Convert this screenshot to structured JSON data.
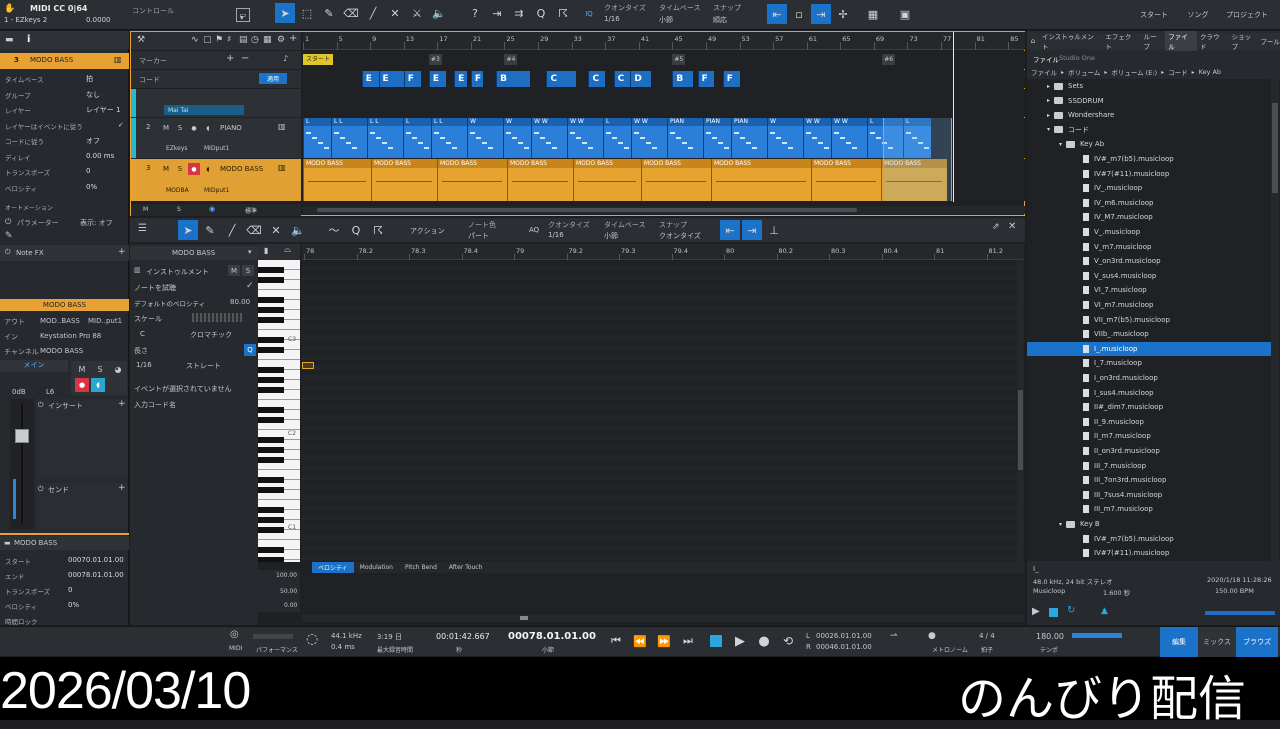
{
  "colors": {
    "accent": "#1b73c9",
    "orange": "#e8a234",
    "bg": "#1c1e21"
  },
  "topbar": {
    "song_title": "MIDI CC 0|64",
    "song_sub": "1 - EZkeys 2",
    "value": "0.0000",
    "control_label": "コントロール",
    "quantize_label": "クオンタイズ",
    "quantize_value": "1/16",
    "timebase_label": "タイムベース",
    "timebase_value": "小節",
    "snap_label": "スナップ",
    "snap_value": "順応",
    "iq": "IQ",
    "nav": [
      "スタート",
      "ソング",
      "プロジェクト"
    ]
  },
  "inspector": {
    "track_num": "3",
    "track_name": "MODO BASS",
    "rows": [
      {
        "label": "タイムベース",
        "value": "拍"
      },
      {
        "label": "グループ",
        "value": "なし"
      },
      {
        "label": "レイヤー",
        "value": "レイヤー 1"
      },
      {
        "label": "レイヤーはイベントに従う",
        "value": "✓"
      },
      {
        "label": "コードに従う",
        "value": "オフ"
      },
      {
        "label": "ディレイ",
        "value": "0.00 ms"
      },
      {
        "label": "トランスポーズ",
        "value": "0"
      },
      {
        "label": "ベロシティ",
        "value": "0%"
      }
    ],
    "automation": "オートメーション",
    "param_label": "パラメーター",
    "param_value": "表示: オフ",
    "note_fx": "Note FX",
    "channel_title": "MODO BASS",
    "out_label": "アウト",
    "out_value": "MOD..BASS",
    "out_value2": "MID..put1",
    "in_label": "イン",
    "in_value": "Keystation Pro 88",
    "ch_label": "チャンネル",
    "ch_value": "MODO BASS",
    "main": "メイン",
    "db": "0dB",
    "pan": "L6",
    "insert": "インサート",
    "send": "センド",
    "event_title": "MODO BASS",
    "event_rows": [
      {
        "label": "スタート",
        "value": "00070.01.01.00"
      },
      {
        "label": "エンド",
        "value": "00078.01.01.00"
      },
      {
        "label": "トランスポーズ",
        "value": "0"
      },
      {
        "label": "ベロシティ",
        "value": "0%"
      },
      {
        "label": "時間ロック",
        "value": ""
      }
    ]
  },
  "arrange": {
    "ruler": [
      "1",
      "5",
      "9",
      "13",
      "17",
      "21",
      "25",
      "29",
      "33",
      "37",
      "41",
      "45",
      "49",
      "53",
      "57",
      "61",
      "65",
      "69",
      "73",
      "77",
      "81",
      "85"
    ],
    "marker_label": "マーカー",
    "chord_label": "コード",
    "chord_btn": "適用",
    "start_marker": "スタート",
    "markers": [
      "#3",
      "#4",
      "#5",
      "#6"
    ],
    "chords": [
      "E",
      "E",
      "F",
      "E",
      "E",
      "F",
      "B",
      "C",
      "C",
      "C",
      "D",
      "B",
      "F",
      "F"
    ],
    "tracks": [
      {
        "num": "",
        "name": "Mai Tai",
        "sub": ""
      },
      {
        "num": "2",
        "name": "PIANO",
        "sub": "EZkeys",
        "sub2": "MIDput1"
      },
      {
        "num": "3",
        "name": "MODO BASS",
        "sub": "MODBA",
        "sub2": "MIDput1"
      }
    ],
    "piano_clips": [
      "L",
      "L L",
      "L L",
      "L",
      "L L",
      "W",
      "W",
      "W W",
      "W W",
      "L",
      "W W",
      "PIAN",
      "PIAN",
      "PIAN",
      "W",
      "W W",
      "W W",
      "L",
      "L"
    ],
    "bass_clips": [
      "MODO BASS",
      "MODO BASS",
      "MODO BASS",
      "MODO BASS",
      "MODO BASS",
      "MODO BASS",
      "MODO BASS",
      "MODO BASS",
      "MODO BASS"
    ],
    "footer_m": "M",
    "footer_s": "S",
    "footer_std": "標準"
  },
  "editor": {
    "action": "アクション",
    "notecolor_label": "ノート色",
    "notecolor_value": "パート",
    "quantize_label": "クオンタイズ",
    "quantize_value": "1/16",
    "timebase_label": "タイムベース",
    "timebase_value": "小節",
    "snap_label": "スナップ",
    "snap_value": "クオンタイズ",
    "aq": "AQ",
    "track_name": "MODO BASS",
    "instrument": "インストゥルメント",
    "note_preview": "ノートを試聴",
    "default_vel_label": "デフォルトのベロシティ",
    "default_vel": "80.00",
    "scale": "スケール",
    "scale_key": "C",
    "scale_type": "クロマチック",
    "length": "長さ",
    "len_value": "1/16",
    "len_type": "ストレート",
    "no_event": "イベントが選択されていません",
    "input_chord": "入力コード名",
    "ruler": [
      "78",
      "78.2",
      "78.3",
      "78.4",
      "79",
      "79.2",
      "79.3",
      "79.4",
      "80",
      "80.2",
      "80.3",
      "80.4",
      "81",
      "81.2"
    ],
    "key_labels": [
      "C3",
      "C2",
      "C1"
    ],
    "lanes": [
      "ベロシティ",
      "Modulation",
      "Pitch Bend",
      "After Touch"
    ],
    "vel_scale": [
      "100.00",
      "50.00",
      "0.00"
    ]
  },
  "browser": {
    "tabs": [
      "インストゥルメント",
      "エフェクト",
      "ループ",
      "ファイル",
      "クラウド",
      "ショップ",
      "プール"
    ],
    "sub1": "ファイル",
    "sub2": "Studio One",
    "crumbs": [
      "ファイル",
      "ボリューム",
      "ボリューム (E:)",
      "コード",
      "Key Ab"
    ],
    "items": [
      {
        "t": "Sets",
        "lvl": 1,
        "type": "folder"
      },
      {
        "t": "SSDDRUM",
        "lvl": 1,
        "type": "folder"
      },
      {
        "t": "Wondershare",
        "lvl": 1,
        "type": "folder"
      },
      {
        "t": "コード",
        "lvl": 1,
        "type": "folder"
      },
      {
        "t": "Key Ab",
        "lvl": 2,
        "type": "folder"
      },
      {
        "t": "IV#_m7(b5).musicloop",
        "lvl": 3,
        "type": "file"
      },
      {
        "t": "IV#7(#11).musicloop",
        "lvl": 3,
        "type": "file"
      },
      {
        "t": "IV_.musicloop",
        "lvl": 3,
        "type": "file"
      },
      {
        "t": "IV_m6.musicloop",
        "lvl": 3,
        "type": "file"
      },
      {
        "t": "IV_M7.musicloop",
        "lvl": 3,
        "type": "file"
      },
      {
        "t": "V_.musicloop",
        "lvl": 3,
        "type": "file"
      },
      {
        "t": "V_m7.musicloop",
        "lvl": 3,
        "type": "file"
      },
      {
        "t": "V_on3rd.musicloop",
        "lvl": 3,
        "type": "file"
      },
      {
        "t": "V_sus4.musicloop",
        "lvl": 3,
        "type": "file"
      },
      {
        "t": "VI_7.musicloop",
        "lvl": 3,
        "type": "file"
      },
      {
        "t": "VI_m7.musicloop",
        "lvl": 3,
        "type": "file"
      },
      {
        "t": "VII_m7(b5).musicloop",
        "lvl": 3,
        "type": "file"
      },
      {
        "t": "VIIb_.musicloop",
        "lvl": 3,
        "type": "file"
      },
      {
        "t": "I_.musicloop",
        "lvl": 3,
        "type": "file",
        "sel": true
      },
      {
        "t": "I_7.musicloop",
        "lvl": 3,
        "type": "file"
      },
      {
        "t": "I_on3rd.musicloop",
        "lvl": 3,
        "type": "file"
      },
      {
        "t": "I_sus4.musicloop",
        "lvl": 3,
        "type": "file"
      },
      {
        "t": "II#_dim7.musicloop",
        "lvl": 3,
        "type": "file"
      },
      {
        "t": "II_9.musicloop",
        "lvl": 3,
        "type": "file"
      },
      {
        "t": "II_m7.musicloop",
        "lvl": 3,
        "type": "file"
      },
      {
        "t": "II_on3rd.musicloop",
        "lvl": 3,
        "type": "file"
      },
      {
        "t": "III_7.musicloop",
        "lvl": 3,
        "type": "file"
      },
      {
        "t": "III_7on3rd.musicloop",
        "lvl": 3,
        "type": "file"
      },
      {
        "t": "III_7sus4.musicloop",
        "lvl": 3,
        "type": "file"
      },
      {
        "t": "III_m7.musicloop",
        "lvl": 3,
        "type": "file"
      },
      {
        "t": "Key B",
        "lvl": 2,
        "type": "folder"
      },
      {
        "t": "IV#_m7(b5).musicloop",
        "lvl": 3,
        "type": "file"
      },
      {
        "t": "IV#7(#11).musicloop",
        "lvl": 3,
        "type": "file"
      }
    ],
    "info_name": "I_",
    "info_fmt": "48.0 kHz, 24 bit ステレオ",
    "info_date": "2020/1/18 11:28:26",
    "info_type": "Musicloop",
    "info_len": "1.600 秒",
    "info_bpm": "150.00 BPM"
  },
  "transport": {
    "midi": "MIDI",
    "perf": "パフォーマンス",
    "rate": "44.1 kHz",
    "latency": "0.4 ms",
    "rec_time": "3:19 日",
    "rec_label": "最大録音時間",
    "time": "00:01:42.667",
    "time_unit": "秒",
    "bars": "00078.01.01.00",
    "bars_unit": "小節",
    "L": "00026.01.01.00",
    "R": "00046.01.01.00",
    "metro": "メトロノーム",
    "sig": "4 / 4",
    "sig_label": "拍子",
    "tempo": "180.00",
    "tempo_label": "テンポ",
    "edit": "編集",
    "mix": "ミックス",
    "browse": "ブラウズ"
  },
  "overlay": {
    "date": "2026/03/10",
    "caption": "のんびり配信"
  }
}
